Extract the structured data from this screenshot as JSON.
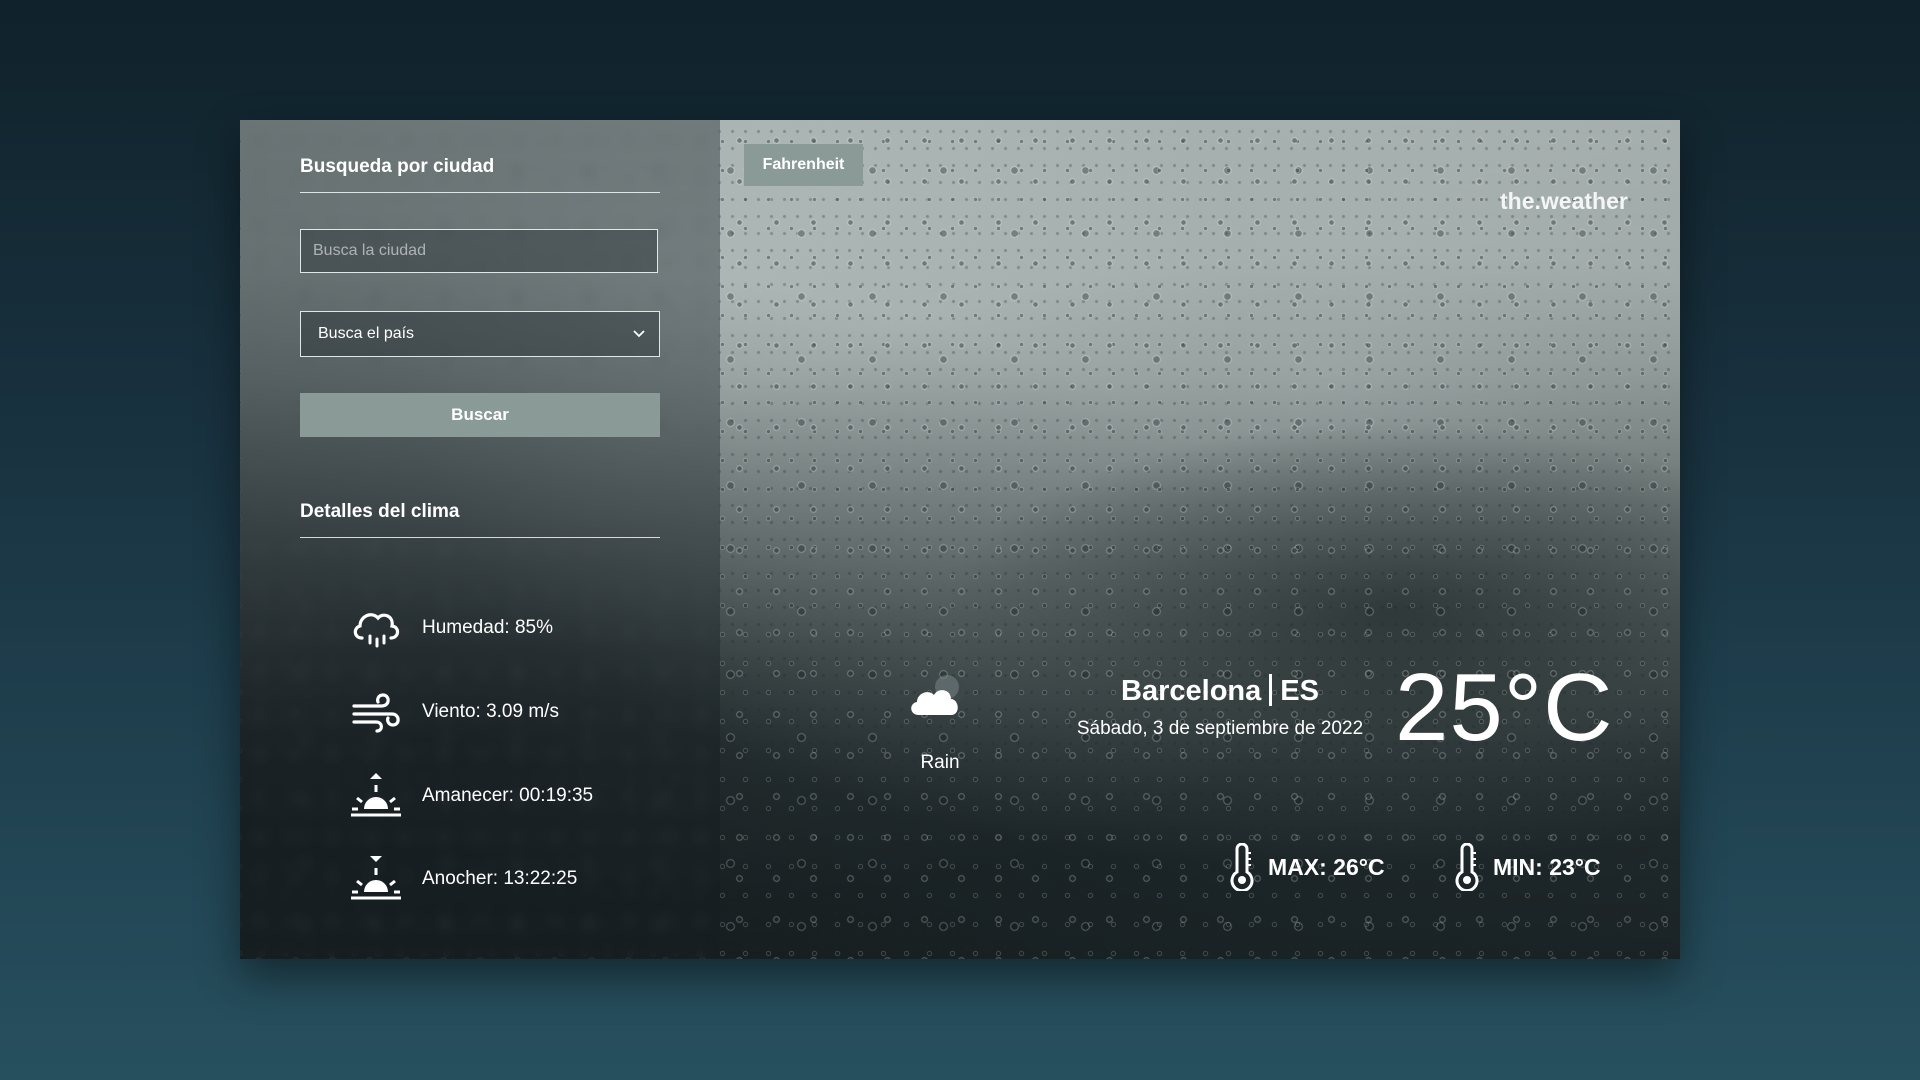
{
  "search": {
    "title": "Busqueda por ciudad",
    "city_placeholder": "Busca la ciudad",
    "city_value": "",
    "country_selected": "Busca el país",
    "button_label": "Buscar"
  },
  "details": {
    "title": "Detalles del clima",
    "humidity": "Humedad: 85%",
    "wind": "Viento: 3.09 m/s",
    "sunrise": "Amanecer: 00:19:35",
    "sunset": "Anocher: 13:22:25",
    "icons": [
      "humidity-cloud-icon",
      "wind-icon",
      "sunrise-icon",
      "sunset-icon"
    ]
  },
  "header": {
    "unit_button": "Fahrenheit",
    "brand": "the.weather"
  },
  "current": {
    "condition": "Rain",
    "condition_icon": "cloud-moon-icon",
    "city": "Barcelona",
    "country": "ES",
    "date": "Sábado, 3 de septiembre de 2022",
    "temperature": "25°C",
    "max": "MAX: 26°C",
    "min": "MIN: 23°C"
  },
  "colors": {
    "accent_button": "#8a9a97",
    "page_bg_top": "#10222b",
    "page_bg_bottom": "#27505f"
  }
}
